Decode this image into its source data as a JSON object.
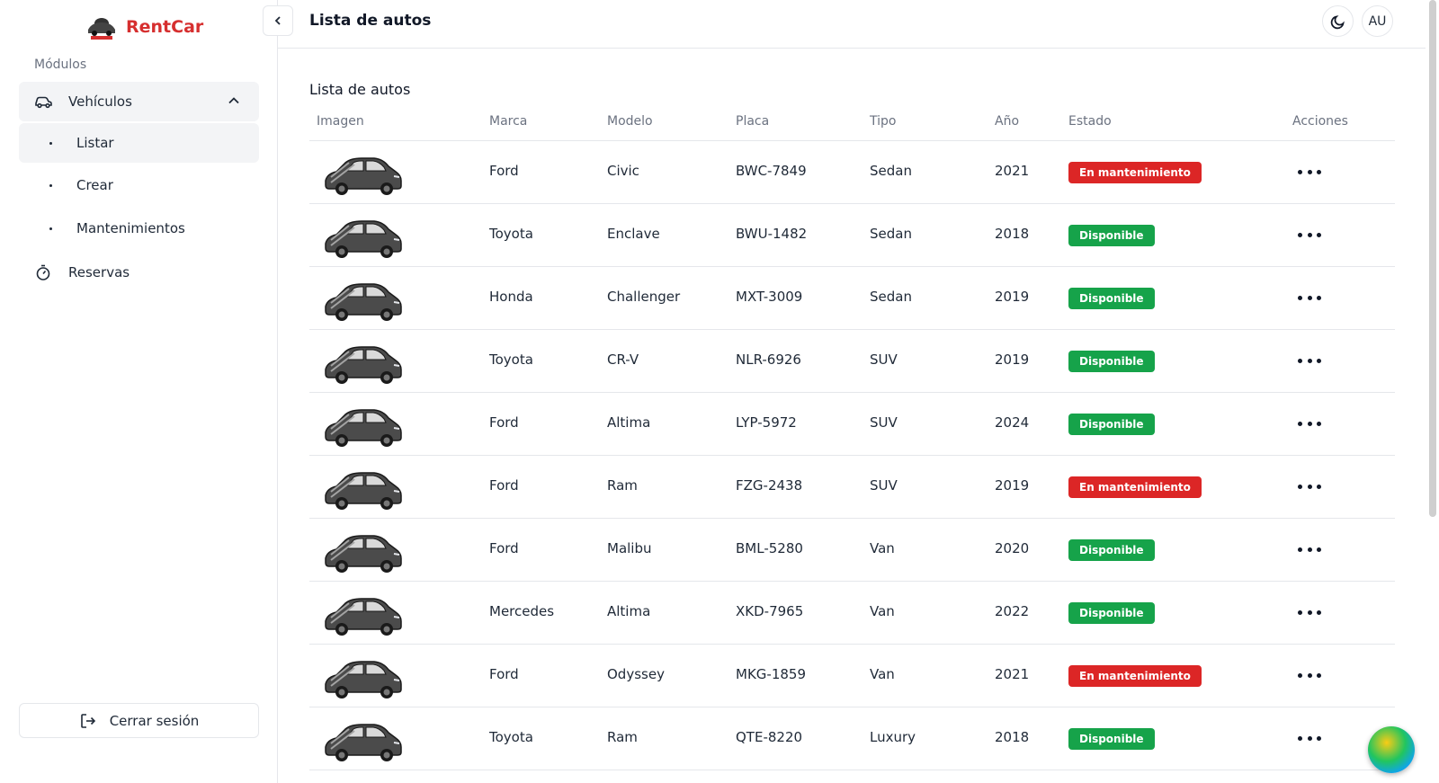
{
  "brand": {
    "name": "RentCar"
  },
  "sidebar": {
    "modules_label": "Módulos",
    "group": {
      "label": "Vehículos",
      "icon": "car-icon"
    },
    "sub_items": [
      {
        "label": "Listar",
        "active": true
      },
      {
        "label": "Crear",
        "active": false
      },
      {
        "label": "Mantenimientos",
        "active": false
      }
    ],
    "reservas": {
      "label": "Reservas",
      "icon": "timer-icon"
    },
    "logout": {
      "label": "Cerrar sesión",
      "icon": "logout-icon"
    }
  },
  "header": {
    "title": "Lista de autos",
    "avatar_initials": "AU",
    "theme_icon": "moon-icon"
  },
  "main": {
    "section_title": "Lista de autos",
    "columns": [
      "Imagen",
      "Marca",
      "Modelo",
      "Placa",
      "Tipo",
      "Año",
      "Estado",
      "Acciones"
    ],
    "rows": [
      {
        "marca": "Ford",
        "modelo": "Civic",
        "placa": "BWC-7849",
        "tipo": "Sedan",
        "anio": "2021",
        "estado": "En mantenimiento"
      },
      {
        "marca": "Toyota",
        "modelo": "Enclave",
        "placa": "BWU-1482",
        "tipo": "Sedan",
        "anio": "2018",
        "estado": "Disponible"
      },
      {
        "marca": "Honda",
        "modelo": "Challenger",
        "placa": "MXT-3009",
        "tipo": "Sedan",
        "anio": "2019",
        "estado": "Disponible"
      },
      {
        "marca": "Toyota",
        "modelo": "CR-V",
        "placa": "NLR-6926",
        "tipo": "SUV",
        "anio": "2019",
        "estado": "Disponible"
      },
      {
        "marca": "Ford",
        "modelo": "Altima",
        "placa": "LYP-5972",
        "tipo": "SUV",
        "anio": "2024",
        "estado": "Disponible"
      },
      {
        "marca": "Ford",
        "modelo": "Ram",
        "placa": "FZG-2438",
        "tipo": "SUV",
        "anio": "2019",
        "estado": "En mantenimiento"
      },
      {
        "marca": "Ford",
        "modelo": "Malibu",
        "placa": "BML-5280",
        "tipo": "Van",
        "anio": "2020",
        "estado": "Disponible"
      },
      {
        "marca": "Mercedes",
        "modelo": "Altima",
        "placa": "XKD-7965",
        "tipo": "Van",
        "anio": "2022",
        "estado": "Disponible"
      },
      {
        "marca": "Ford",
        "modelo": "Odyssey",
        "placa": "MKG-1859",
        "tipo": "Van",
        "anio": "2021",
        "estado": "En mantenimiento"
      },
      {
        "marca": "Toyota",
        "modelo": "Ram",
        "placa": "QTE-8220",
        "tipo": "Luxury",
        "anio": "2018",
        "estado": "Disponible"
      }
    ]
  },
  "colors": {
    "brand": "#d62f2f",
    "available": "#16a34a",
    "maintenance": "#dc2626"
  }
}
